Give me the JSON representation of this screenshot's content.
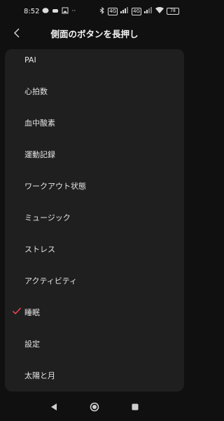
{
  "status_bar": {
    "time": "8:52",
    "left_icons": [
      "messenger-icon",
      "game-icon",
      "image-icon",
      "more-icon"
    ],
    "right_icons": [
      "bluetooth-icon",
      "signal-icon",
      "signal-icon",
      "wifi-icon",
      "battery-icon"
    ],
    "battery": "78"
  },
  "header": {
    "title": "側面のボタンを長押し"
  },
  "options": [
    {
      "label": "PAI",
      "selected": false
    },
    {
      "label": "心拍数",
      "selected": false
    },
    {
      "label": "血中酸素",
      "selected": false
    },
    {
      "label": "運動記録",
      "selected": false
    },
    {
      "label": "ワークアウト状態",
      "selected": false
    },
    {
      "label": "ミュージック",
      "selected": false
    },
    {
      "label": "ストレス",
      "selected": false
    },
    {
      "label": "アクティビティ",
      "selected": false
    },
    {
      "label": "睡眠",
      "selected": true
    },
    {
      "label": "設定",
      "selected": false
    },
    {
      "label": "太陽と月",
      "selected": false
    }
  ],
  "colors": {
    "background": "#101010",
    "card": "#1f1f1f",
    "check": "#e8454c"
  }
}
